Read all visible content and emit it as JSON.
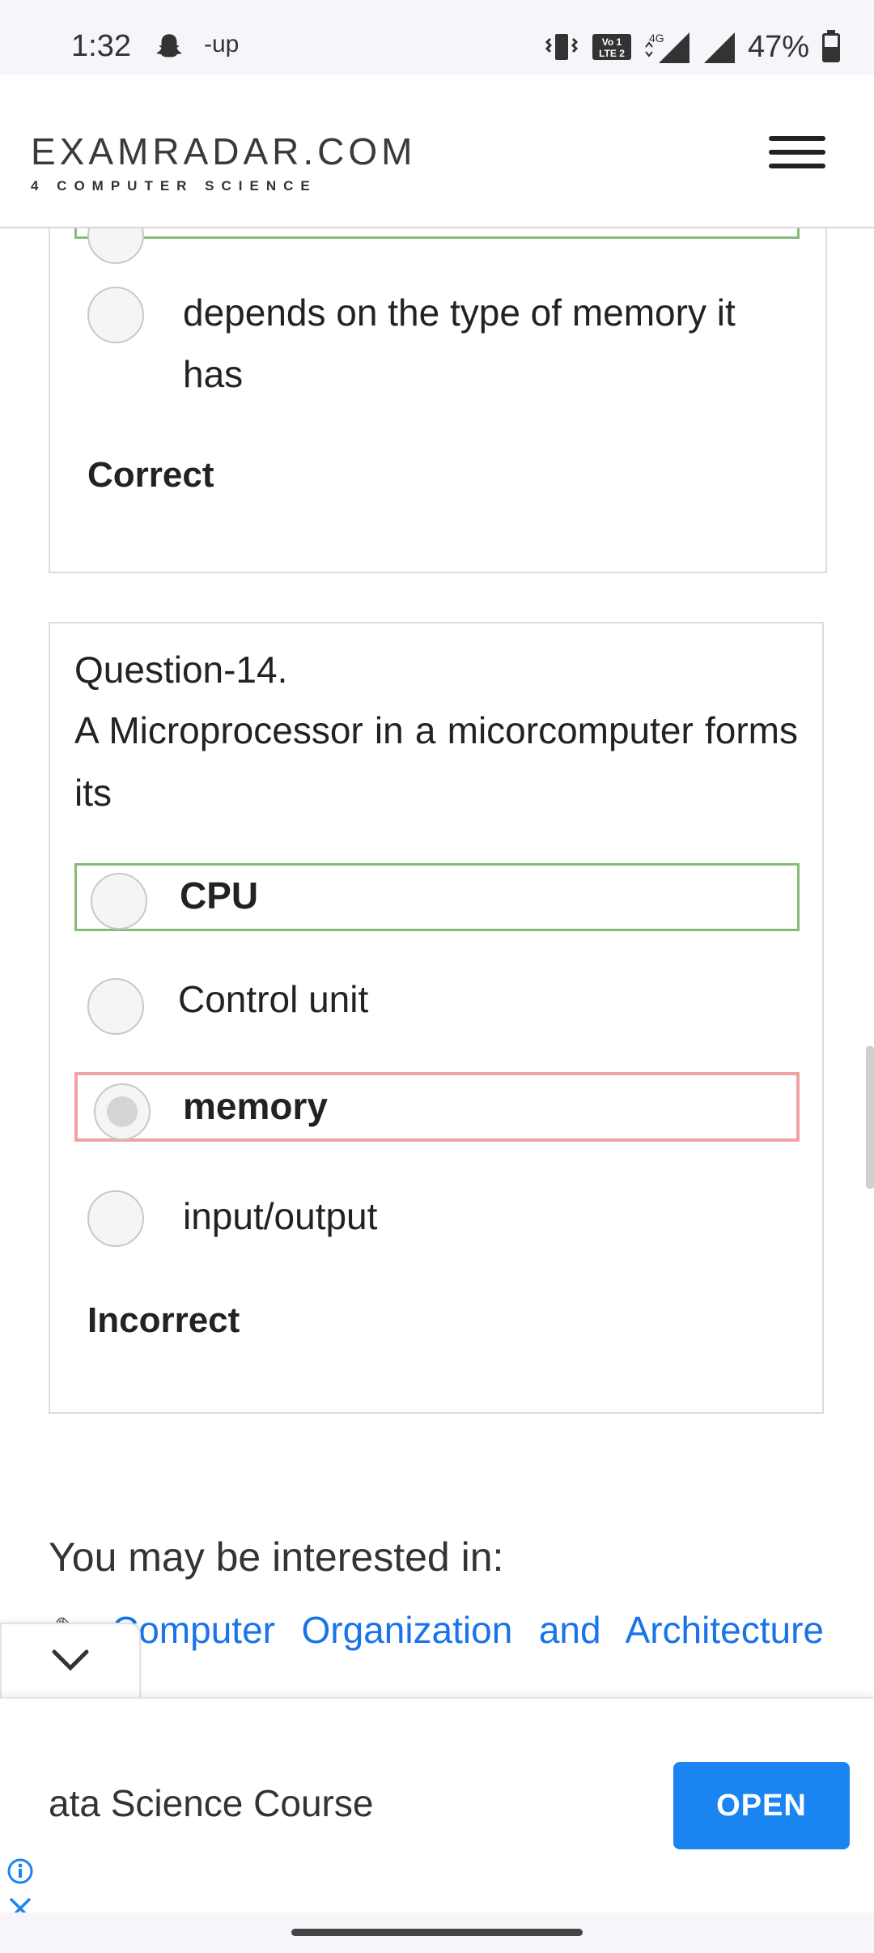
{
  "status_bar": {
    "time": "1:32",
    "up_label": "-up",
    "network": "4G",
    "volte_label": "Vo LTE 2",
    "battery": "47%"
  },
  "header": {
    "logo": "EXAMRADAR.COM",
    "tagline": "4 COMPUTER SCIENCE",
    "menu_icon": "hamburger-icon"
  },
  "question13": {
    "options": [
      {
        "text": "depends on the type of memory it has",
        "selected": false
      }
    ],
    "result": "Correct"
  },
  "question14": {
    "number": "Question-14.",
    "text": "A Microprocessor in a micorcomputer forms its",
    "options": [
      {
        "text": "CPU",
        "state": "correct-answer"
      },
      {
        "text": "Control unit",
        "state": "none"
      },
      {
        "text": "memory",
        "state": "selected-wrong"
      },
      {
        "text": "input/output",
        "state": "none"
      }
    ],
    "result": "Incorrect"
  },
  "related": {
    "heading": "You may be interested in:",
    "link": "Computer Organization and Architecture"
  },
  "ad": {
    "text": "ata Science Course",
    "button": "OPEN",
    "accent": "#1a84f0"
  },
  "colors": {
    "correct_border": "#86bb7a",
    "wrong_border": "#f0a3a6",
    "link": "#1a73e8"
  }
}
